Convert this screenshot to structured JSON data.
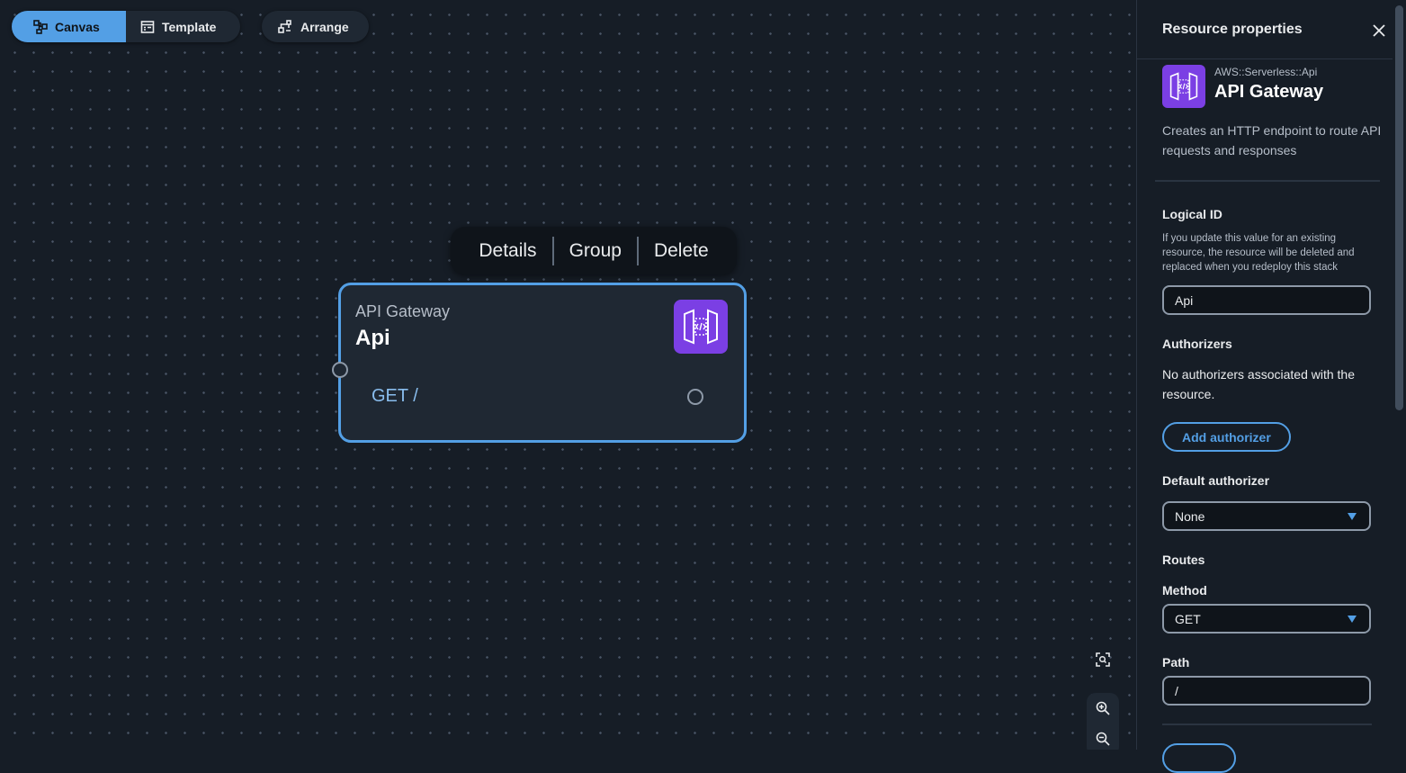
{
  "toolbar": {
    "canvas_label": "Canvas",
    "template_label": "Template",
    "arrange_label": "Arrange"
  },
  "context_menu": {
    "details": "Details",
    "group": "Group",
    "delete": "Delete"
  },
  "node": {
    "type": "API Gateway",
    "name": "Api",
    "route": "GET /"
  },
  "panel": {
    "title": "Resource properties",
    "resource_kind": "AWS::Serverless::Api",
    "resource_name": "API Gateway",
    "description": "Creates an HTTP endpoint to route API requests and responses",
    "logical_id": {
      "label": "Logical ID",
      "hint": "If you update this value for an existing resource, the resource will be deleted and replaced when you redeploy this stack",
      "value": "Api"
    },
    "authorizers": {
      "label": "Authorizers",
      "empty_text": "No authorizers associated with the resource.",
      "add_button": "Add authorizer"
    },
    "default_authorizer": {
      "label": "Default authorizer",
      "value": "None"
    },
    "routes": {
      "label": "Routes",
      "method_label": "Method",
      "method_value": "GET",
      "path_label": "Path",
      "path_value": "/"
    }
  },
  "colors": {
    "accent": "#539fe5",
    "api_icon_bg": "#7b3fe4",
    "background": "#161d26"
  },
  "icons": [
    "canvas-icon",
    "template-icon",
    "arrange-icon",
    "api-gateway-icon",
    "close-icon",
    "fit-view-icon",
    "zoom-in-icon",
    "zoom-out-icon"
  ]
}
